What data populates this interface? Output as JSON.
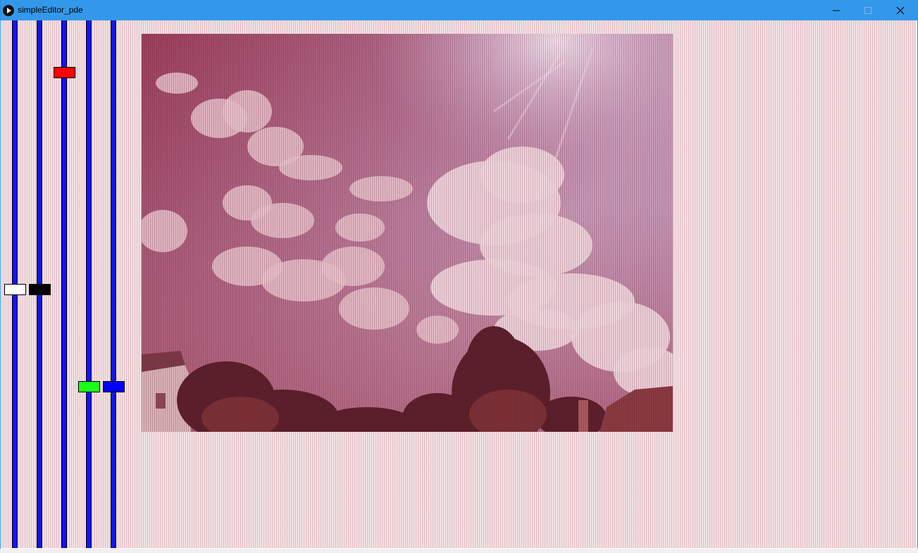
{
  "window": {
    "title": "simpleEditor_pde",
    "controls": {
      "minimize": "minimize-icon",
      "maximize": "maximize-icon",
      "close": "close-icon"
    }
  },
  "colors": {
    "titlebar": "#3498ea",
    "canvas_background": "#f4e4e6",
    "slider_track": "#1313f2"
  },
  "sliders": [
    {
      "name": "slider-white",
      "handle_color": "#ffffff",
      "value_fraction": 0.52
    },
    {
      "name": "slider-black",
      "handle_color": "#000000",
      "value_fraction": 0.52
    },
    {
      "name": "slider-red",
      "handle_color": "#ff0000",
      "value_fraction": 0.09
    },
    {
      "name": "slider-green",
      "handle_color": "#1aff1a",
      "value_fraction": 0.7
    },
    {
      "name": "slider-blue",
      "handle_color": "#0000ff",
      "value_fraction": 0.7
    }
  ],
  "image": {
    "subject": "sky-with-clouds-and-trees-photo"
  }
}
